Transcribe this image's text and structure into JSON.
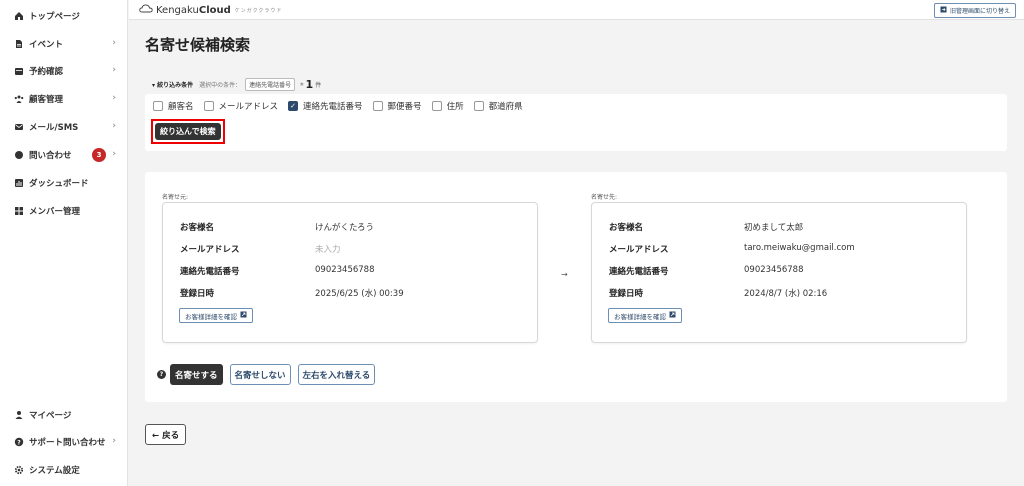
{
  "sidebar": {
    "items": [
      {
        "label": "トップページ",
        "icon": "home-icon"
      },
      {
        "label": "イベント",
        "icon": "document-icon"
      },
      {
        "label": "予約確認",
        "icon": "calendar-icon"
      },
      {
        "label": "顧客管理",
        "icon": "people-icon"
      },
      {
        "label": "メール/SMS",
        "icon": "mail-icon"
      },
      {
        "label": "問い合わせ",
        "icon": "chat-icon",
        "badge": "3"
      },
      {
        "label": "ダッシュボード",
        "icon": "chart-icon"
      },
      {
        "label": "メンバー管理",
        "icon": "grid-icon"
      }
    ],
    "bottom_items": [
      {
        "label": "マイページ",
        "icon": "user-icon"
      },
      {
        "label": "サポート問い合わせ",
        "icon": "help-icon"
      },
      {
        "label": "システム設定",
        "icon": "gear-icon"
      }
    ]
  },
  "topbar": {
    "brand_prefix": "Kengaku",
    "brand_suffix": "Cloud",
    "brand_sub": "ケンガククラウド",
    "switch_label": "旧管理画面に切り替え"
  },
  "page": {
    "title": "名寄せ候補検索"
  },
  "filter": {
    "label": "▾ 絞り込み条件",
    "selected_label": "選択中の条件：",
    "selected_chip": "連絡先電話番号",
    "count": "1",
    "count_unit": "件",
    "options": [
      {
        "label": "顧客名",
        "checked": false
      },
      {
        "label": "メールアドレス",
        "checked": false
      },
      {
        "label": "連絡先電話番号",
        "checked": true
      },
      {
        "label": "郵便番号",
        "checked": false
      },
      {
        "label": "住所",
        "checked": false
      },
      {
        "label": "都道府県",
        "checked": false
      }
    ],
    "search_button": "絞り込んで検索"
  },
  "merge": {
    "source": {
      "label": "名寄せ元:",
      "name_key": "お客様名",
      "name_val": "けんがくたろう",
      "email_key": "メールアドレス",
      "email_val": "未入力",
      "phone_key": "連絡先電話番号",
      "phone_val": "09023456788",
      "date_key": "登録日時",
      "date_val": "2025/6/25 (水) 00:39",
      "detail_button": "お客様詳細を確認"
    },
    "arrow": "→",
    "target": {
      "label": "名寄せ先:",
      "name_key": "お客様名",
      "name_val": "初めまして太郎",
      "email_key": "メールアドレス",
      "email_val": "taro.meiwaku@gmail.com",
      "phone_key": "連絡先電話番号",
      "phone_val": "09023456788",
      "date_key": "登録日時",
      "date_val": "2024/8/7 (水) 02:16",
      "detail_button": "お客様詳細を確認"
    },
    "help_icon": "?",
    "merge_button": "名寄せする",
    "no_merge_button": "名寄せしない",
    "swap_button": "左右を入れ替える"
  },
  "back_button": "← 戻る"
}
